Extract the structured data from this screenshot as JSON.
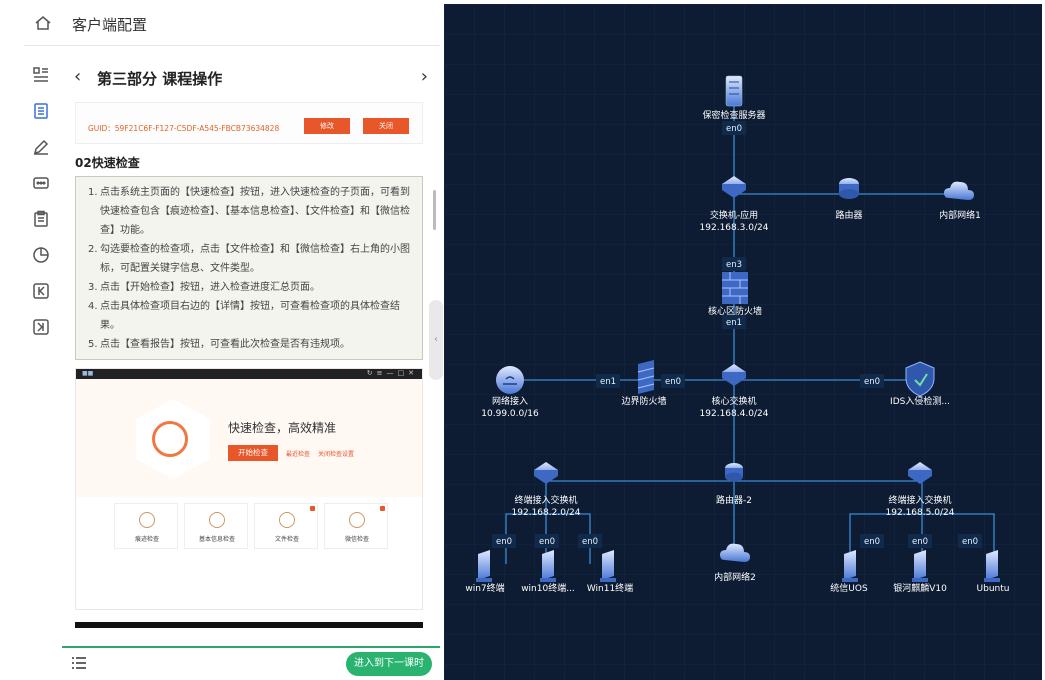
{
  "header": {
    "title": "客户端配置"
  },
  "panel": {
    "title": "第三部分 课程操作",
    "guid_card": {
      "guid": "GUID：59F21C6F-F127-C5DF-A545-FBCB73634828",
      "modify": "修改",
      "close": "关闭"
    },
    "section_title": "02快速检查",
    "steps": [
      {
        "n": "1.",
        "text": "点击系统主页面的【快速检查】按钮，进入快速检查的子页面，可看到快速检查包含【痕迹检查】、【基本信息检查】、【文件检查】和【微信检查】功能。"
      },
      {
        "n": "2.",
        "text": "勾选要检查的检查项，点击【文件检查】和【微信检查】右上角的小图标，可配置关键字信息、文件类型。"
      },
      {
        "n": "3.",
        "text": "点击【开始检查】按钮，进入检查进度汇总页面。"
      },
      {
        "n": "4.",
        "text": "点击具体检查项目右边的【详情】按钮，可查看检查项的具体检查结果。"
      },
      {
        "n": "5.",
        "text": "点击【查看报告】按钮，可查看此次检查是否有违规项。"
      }
    ],
    "screenshot": {
      "headline": "快速检查，高效精准",
      "start": "开始检查",
      "link1": "最近检查",
      "link2": "关闭检查设置",
      "cards": [
        "痕迹检查",
        "基本信息检查",
        "文件检查",
        "微信检查"
      ]
    },
    "next_button": "进入到下一课时"
  },
  "topology": {
    "nodes": [
      {
        "id": "secserver",
        "label": "保密检查服务器",
        "icon": "server-icon"
      },
      {
        "id": "sw_app",
        "label": "交换机-应用",
        "sub": "192.168.3.0/24",
        "icon": "switch-icon"
      },
      {
        "id": "router1",
        "label": "路由器",
        "icon": "router-icon"
      },
      {
        "id": "intnet1",
        "label": "内部网络1",
        "icon": "cloud-icon"
      },
      {
        "id": "corefw",
        "label": "核心区防火墙",
        "icon": "firewall-icon"
      },
      {
        "id": "netin",
        "label": "网络接入",
        "sub": "10.99.0.0/16",
        "icon": "router-icon"
      },
      {
        "id": "edgefw",
        "label": "边界防火墙",
        "icon": "firewall-icon"
      },
      {
        "id": "coresw",
        "label": "核心交换机",
        "sub": "192.168.4.0/24",
        "icon": "switch-icon"
      },
      {
        "id": "ids",
        "label": "IDS入侵检测...",
        "icon": "shield-icon"
      },
      {
        "id": "acc1",
        "label": "终端接入交换机",
        "sub": "192.168.2.0/24",
        "icon": "switch-icon"
      },
      {
        "id": "router2",
        "label": "路由器-2",
        "icon": "router-icon"
      },
      {
        "id": "acc2",
        "label": "终端接入交换机",
        "sub": "192.168.5.0/24",
        "icon": "switch-icon"
      },
      {
        "id": "win7",
        "label": "win7终端",
        "icon": "terminal-icon"
      },
      {
        "id": "win10",
        "label": "win10终端...",
        "icon": "terminal-icon"
      },
      {
        "id": "win11",
        "label": "Win11终端",
        "icon": "terminal-icon"
      },
      {
        "id": "intnet2",
        "label": "内部网络2",
        "icon": "cloud-icon"
      },
      {
        "id": "uos",
        "label": "统信UOS",
        "icon": "terminal-icon"
      },
      {
        "id": "kylin",
        "label": "银河麒麟V10",
        "icon": "terminal-icon"
      },
      {
        "id": "ubuntu",
        "label": "Ubuntu",
        "icon": "terminal-icon"
      }
    ],
    "ports": [
      "en0",
      "en0",
      "en3",
      "en1",
      "en1",
      "en0",
      "en0",
      "en0",
      "en0",
      "en0",
      "en0",
      "en0",
      "en0"
    ]
  }
}
